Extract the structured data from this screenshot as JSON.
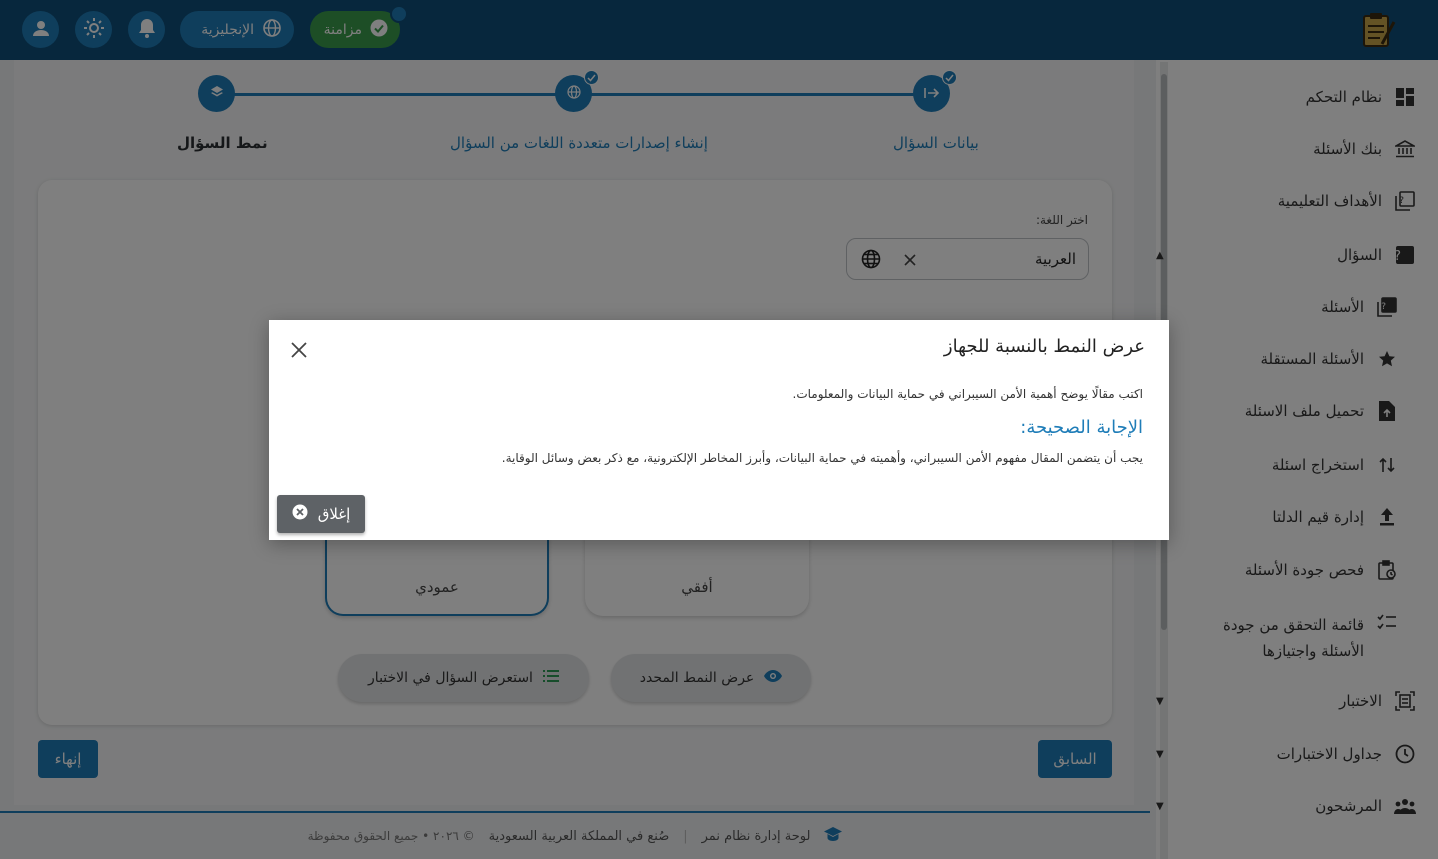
{
  "topbar": {
    "language_label": "الإنجليزية",
    "sync_label": "مزامنة",
    "icons": [
      "user-icon",
      "sun-icon",
      "bell-icon",
      "globe-icon",
      "check-circle-icon"
    ]
  },
  "sidebar": {
    "items": [
      {
        "label": "نظام التحكم",
        "icon": "dashboard-icon"
      },
      {
        "label": "بنك الأسئلة",
        "icon": "bank-icon"
      },
      {
        "label": "الأهداف التعليمية",
        "icon": "objectives-icon"
      },
      {
        "label": "السؤال",
        "icon": "question-icon",
        "expanded": true
      },
      {
        "label": "الأسئلة",
        "icon": "questions-icon",
        "sub": true
      },
      {
        "label": "الأسئلة المستقلة",
        "icon": "star-icon",
        "sub": true
      },
      {
        "label": "تحميل ملف الاسئلة",
        "icon": "file-upload-icon",
        "sub": true
      },
      {
        "label": "استخراج اسئلة",
        "icon": "extract-icon",
        "sub": true
      },
      {
        "label": "إدارة قيم الدلتا",
        "icon": "upload-icon",
        "sub": true
      },
      {
        "label": "فحص جودة الأسئلة",
        "icon": "clipboard-check-icon",
        "sub": true
      },
      {
        "label": "قائمة التحقق من جودة الأسئلة واجتيازها",
        "icon": "checklist-icon",
        "sub": true
      },
      {
        "label": "الاختبار",
        "icon": "exam-icon"
      },
      {
        "label": "جداول الاختبارات",
        "icon": "clock-icon"
      },
      {
        "label": "المرشحون",
        "icon": "people-icon"
      }
    ]
  },
  "stepper": {
    "steps": [
      {
        "label": "بيانات السؤال",
        "done": true
      },
      {
        "label": "إنشاء إصدارات متعددة اللغات من السؤال",
        "done": true
      },
      {
        "label": "نمط السؤال",
        "active": true
      }
    ]
  },
  "form": {
    "language_label": "اختر اللغة:",
    "language_value": "العربية"
  },
  "layouts": {
    "vertical": "عمودي",
    "horizontal": "أفقي"
  },
  "actions": {
    "preview_in_exam": "استعرض السؤال في الاختبار",
    "show_selected_layout": "عرض النمط المحدد",
    "previous": "السابق",
    "finish": "إنهاء"
  },
  "footer": {
    "dashboard": "لوحة إدارة نظام نمر",
    "made_in": "صُنع في المملكة العربية السعودية",
    "copyright": "© ٢٠٢٦ • جميع الحقوق محفوظة"
  },
  "modal": {
    "title": "عرض النمط بالنسبة للجهاز",
    "question": "اكتب مقالًا يوضح أهمية الأمن السيبراني في حماية البيانات والمعلومات.",
    "answer_heading": "الإجابة الصحيحة:",
    "answer": "يجب أن يتضمن المقال مفهوم الأمن السيبراني، وأهميته في حماية البيانات، وأبرز المخاطر الإلكترونية، مع ذكر بعض وسائل الوقاية.",
    "close_label": "إغلاق"
  },
  "colors": {
    "topbar": "#0f4f7a",
    "accent": "#1f7db8",
    "sync": "#3a9d4c"
  }
}
